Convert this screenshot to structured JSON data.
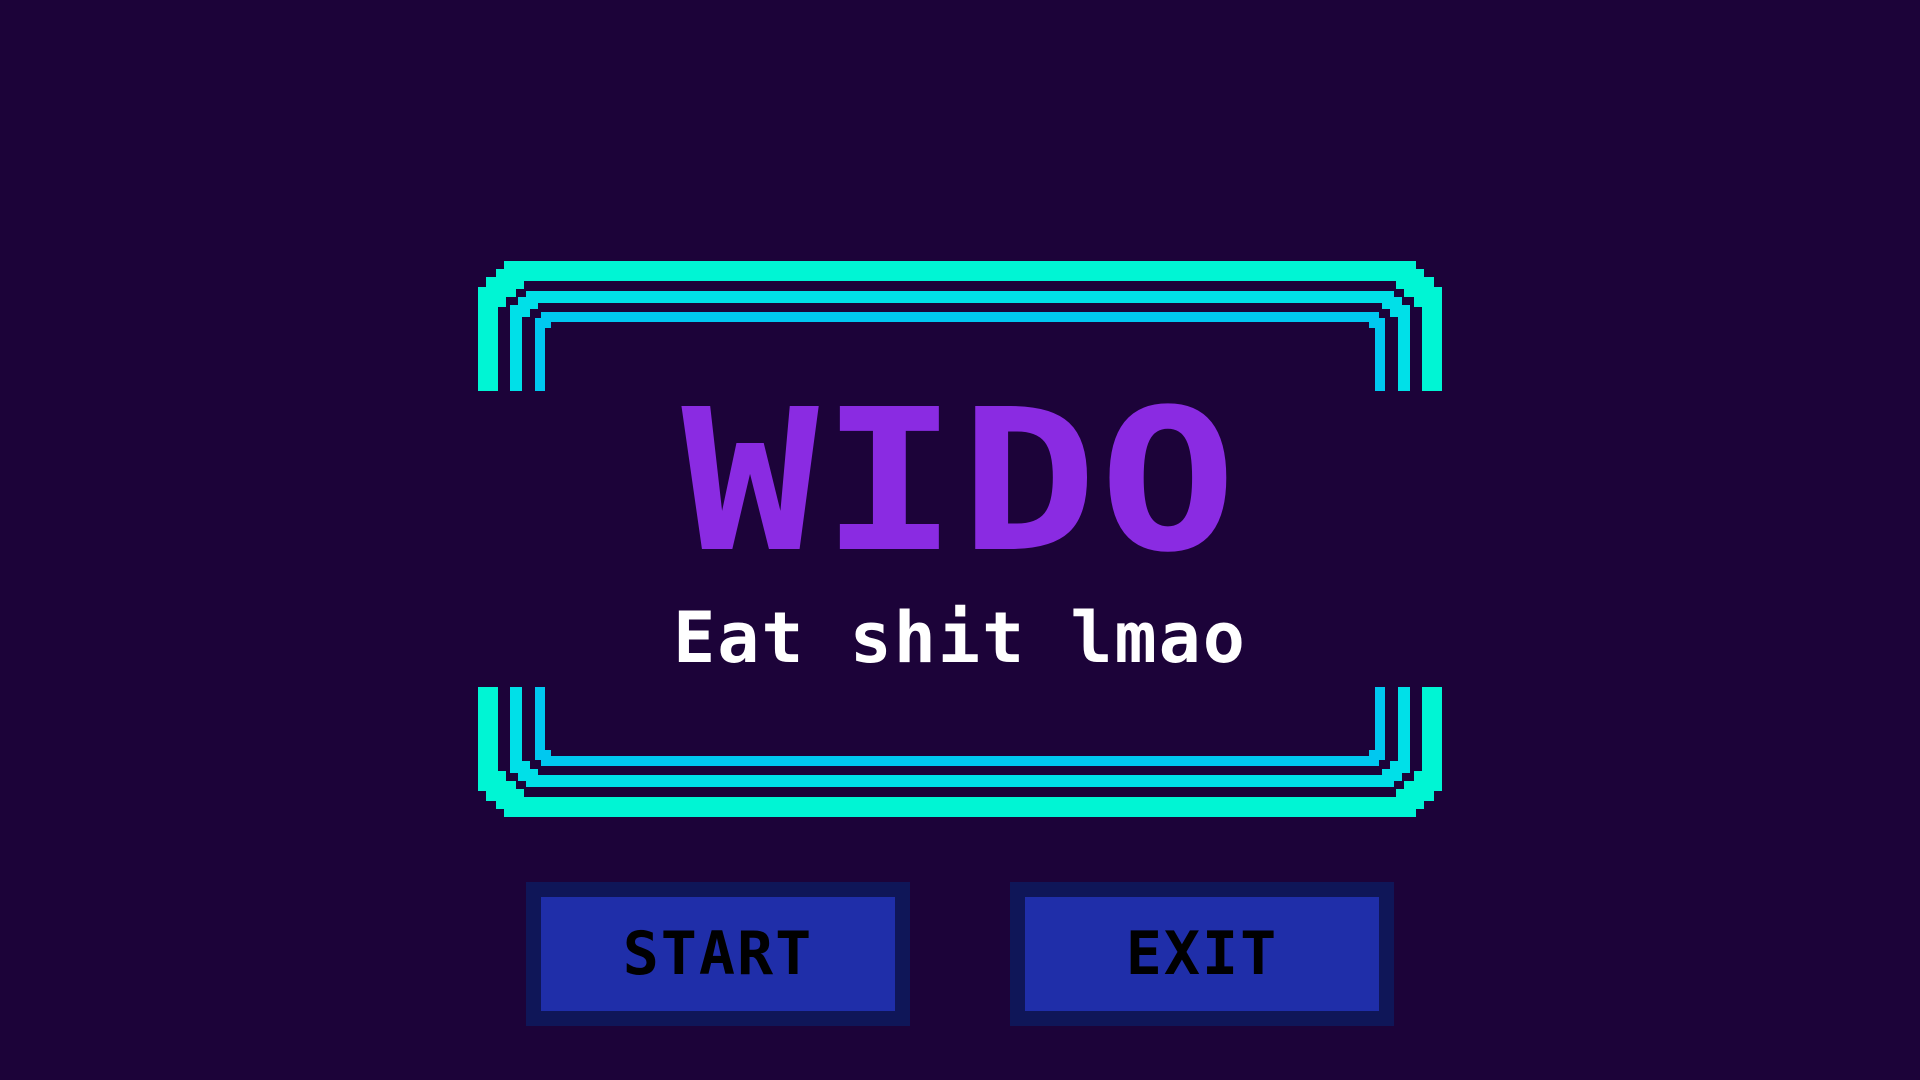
{
  "title_screen": {
    "title": "WIDO",
    "subtitle": "Eat shit lmao"
  },
  "menu": {
    "start_label": "START",
    "exit_label": "EXIT"
  },
  "colors": {
    "background": "#1c0339",
    "title": "#8a2be2",
    "subtitle": "#ffffff",
    "frame_outer": "#00f5d4",
    "frame_middle": "#00e0e8",
    "frame_inner": "#00c8f0",
    "button_border": "#0f1658",
    "button_face": "#1f2ea9",
    "button_text": "#000000"
  },
  "icons": [
    "neon-frame-decoration"
  ]
}
